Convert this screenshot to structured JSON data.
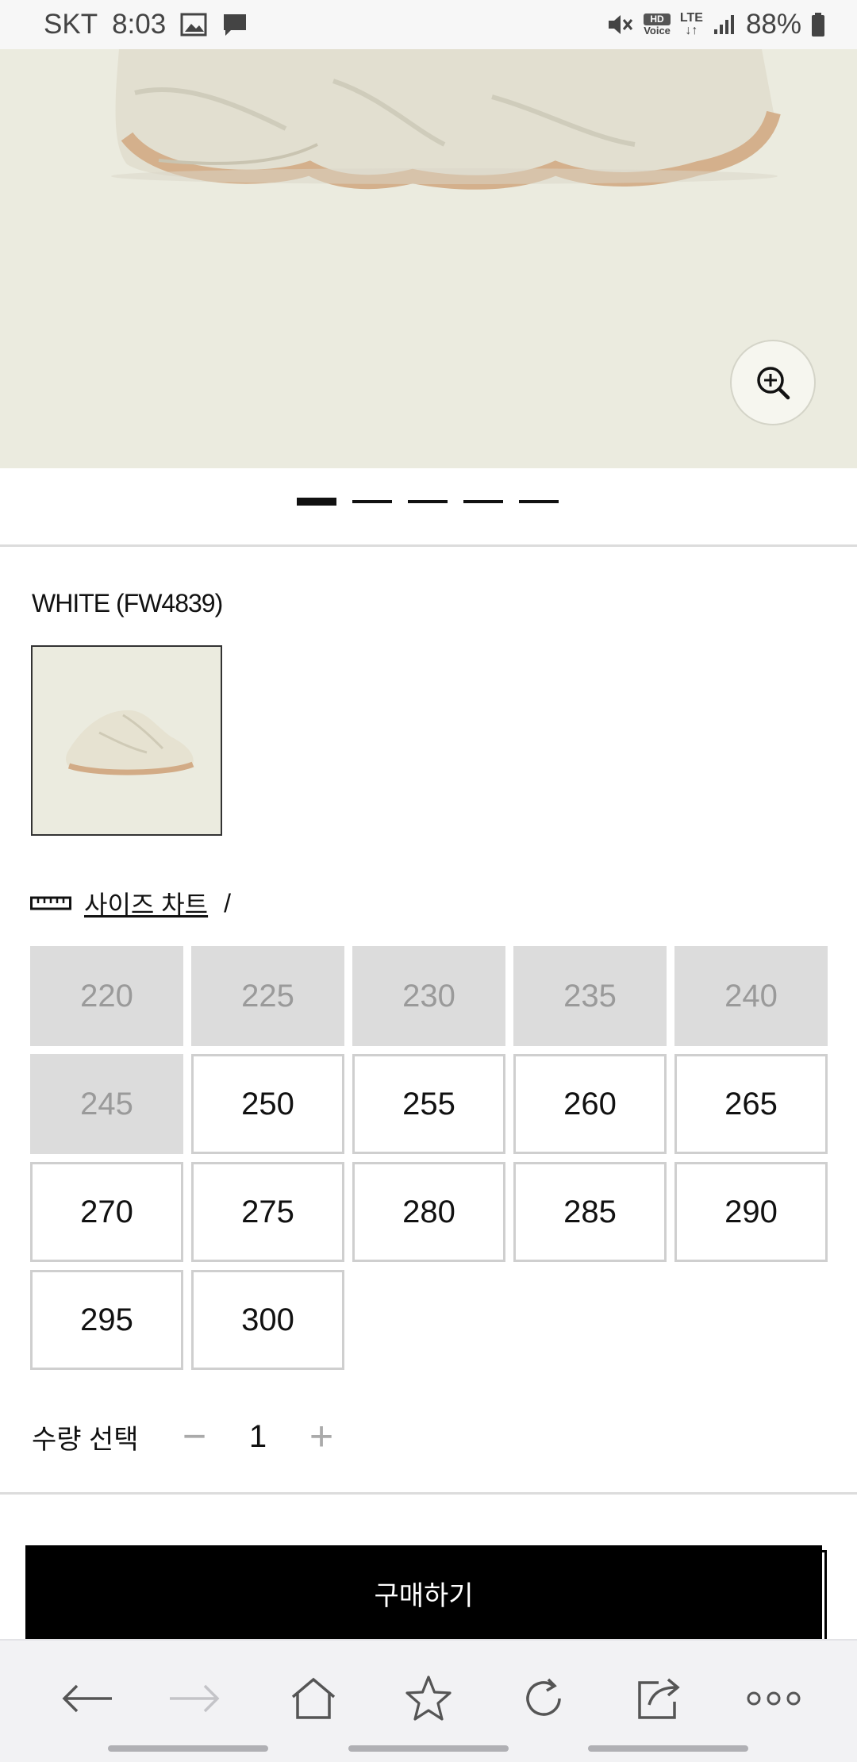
{
  "status_bar": {
    "carrier": "SKT",
    "time": "8:03",
    "hd_voice_top": "HD",
    "hd_voice_bottom": "Voice",
    "network": "LTE",
    "battery": "88%",
    "icons": [
      "image-notification-icon",
      "message-notification-icon",
      "mute-icon",
      "hd-voice-icon",
      "lte-icon",
      "signal-icon",
      "battery-icon"
    ]
  },
  "product": {
    "pager": {
      "total": 5,
      "active_index": 0
    },
    "color_label": "WHITE (FW4839)",
    "size_chart_label": "사이즈 차트",
    "size_chart_separator": "/",
    "sizes": [
      {
        "label": "220",
        "available": false
      },
      {
        "label": "225",
        "available": false
      },
      {
        "label": "230",
        "available": false
      },
      {
        "label": "235",
        "available": false
      },
      {
        "label": "240",
        "available": false
      },
      {
        "label": "245",
        "available": false
      },
      {
        "label": "250",
        "available": true
      },
      {
        "label": "255",
        "available": true
      },
      {
        "label": "260",
        "available": true
      },
      {
        "label": "265",
        "available": true
      },
      {
        "label": "270",
        "available": true
      },
      {
        "label": "275",
        "available": true
      },
      {
        "label": "280",
        "available": true
      },
      {
        "label": "285",
        "available": true
      },
      {
        "label": "290",
        "available": true
      },
      {
        "label": "295",
        "available": true
      },
      {
        "label": "300",
        "available": true
      }
    ],
    "quantity_label": "수량 선택",
    "quantity_minus": "−",
    "quantity_value": "1",
    "quantity_plus": "+",
    "buy_label": "구매하기"
  },
  "toolbar": {
    "items": [
      "back-icon",
      "forward-icon",
      "home-icon",
      "bookmark-star-icon",
      "refresh-icon",
      "share-icon",
      "more-icon"
    ]
  },
  "colors": {
    "hero_bg": "#ebebdf",
    "sold_out_bg": "#dcdcdc",
    "buy_button_bg": "#000000"
  }
}
